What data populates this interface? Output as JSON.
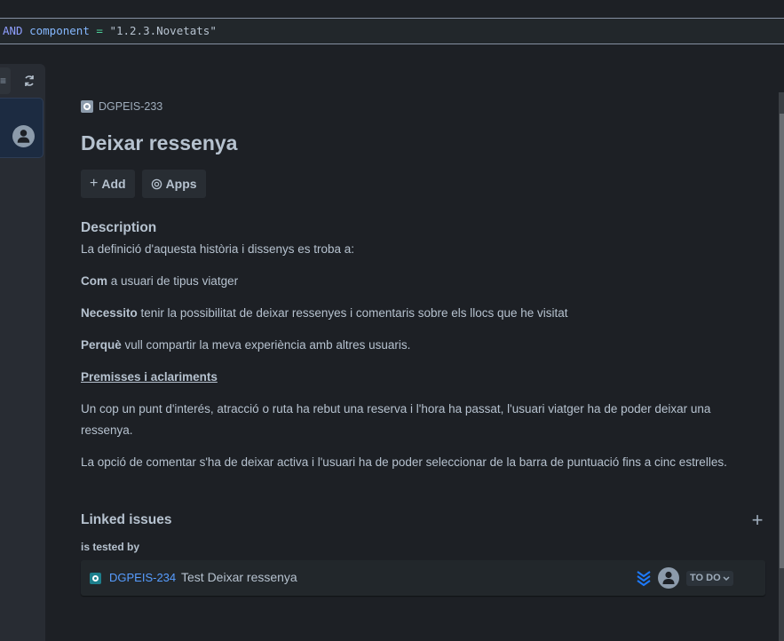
{
  "jql": {
    "keyword": "AND",
    "field": "component",
    "operator": "=",
    "value": "\"1.2.3.Novetats\""
  },
  "left_panel": {
    "filter_icon": "filter-icon",
    "refresh_icon": "refresh-icon",
    "avatar_icon": "user-avatar-icon"
  },
  "issue": {
    "key": "DGPEIS-233",
    "type_icon": "story-icon",
    "title": "Deixar ressenya",
    "actions": [
      {
        "icon": "plus-icon",
        "label": "Add"
      },
      {
        "icon": "apps-icon",
        "label": "Apps"
      }
    ]
  },
  "description": {
    "heading": "Description",
    "paragraphs": {
      "intro": "La definició d'aquesta història i dissenys es troba a:",
      "com_bold": "Com",
      "com_rest": " a usuari de tipus viatger",
      "necessito_bold": "Necessito",
      "necessito_rest": " tenir la possibilitat de deixar ressenyes i comentaris sobre els llocs que he visitat",
      "perque_bold": "Perquè",
      "perque_rest": " vull compartir la meva experiència amb altres usuaris.",
      "premisses": "Premisses i aclariments",
      "p1": "Un cop un punt d'interés, atracció o ruta ha rebut una reserva i l'hora ha passat, l'usuari viatger ha de poder deixar una ressenya.",
      "p2": "La opció de comentar s'ha de deixar activa i l'usuari ha de poder seleccionar de la barra de puntuació fins a cinc estrelles."
    }
  },
  "linked_issues": {
    "heading": "Linked issues",
    "add_icon": "plus-icon",
    "relation": "is tested by",
    "items": [
      {
        "key": "DGPEIS-234",
        "summary": "Test Deixar ressenya",
        "priority": "lowest",
        "status": "TO DO",
        "colors": {
          "key": "#579dff",
          "priority": "#1d7afc",
          "type": "#1d7f8c"
        }
      }
    ]
  }
}
